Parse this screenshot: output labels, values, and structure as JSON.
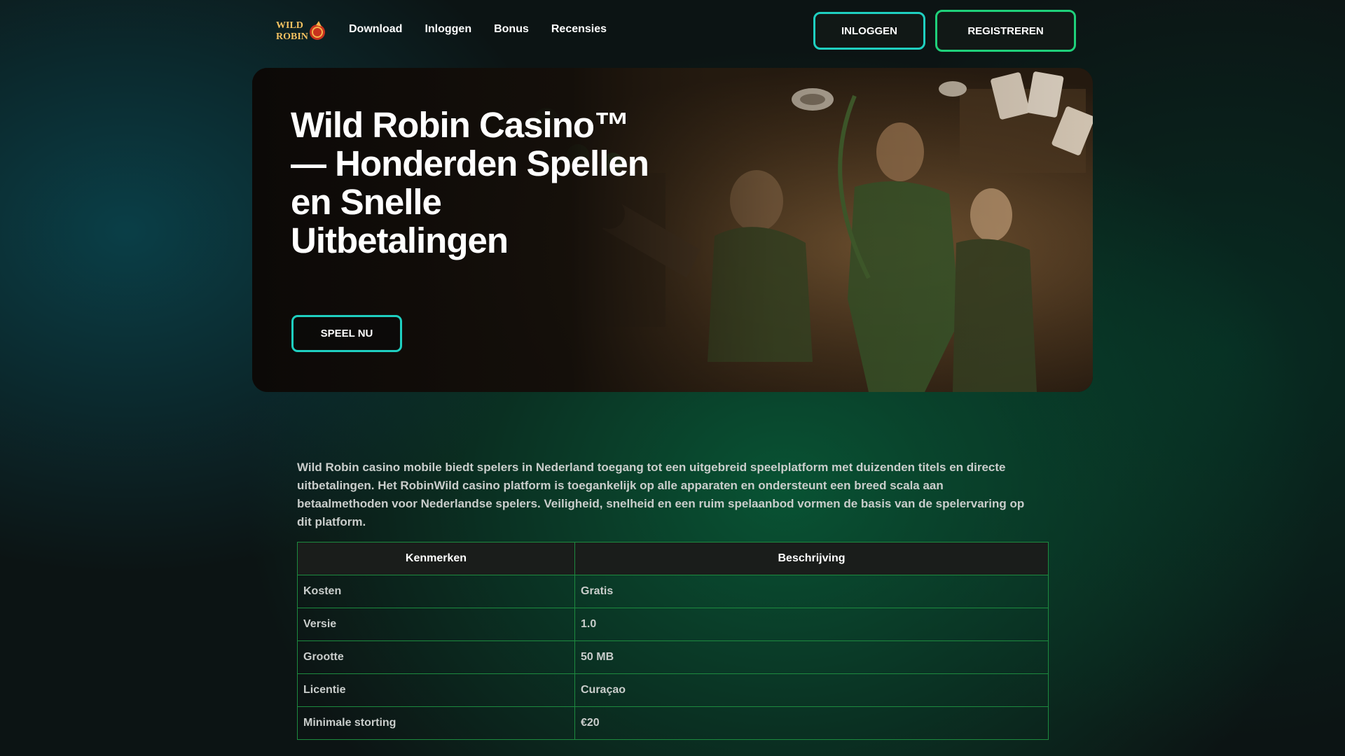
{
  "header": {
    "logo_text": [
      "WILD",
      "ROBIN"
    ],
    "nav": [
      "Download",
      "Inloggen",
      "Bonus",
      "Recensies"
    ],
    "login_label": "INLOGGEN",
    "register_label": "REGISTREREN"
  },
  "hero": {
    "title": "Wild Robin Casino™ — Honderden Spellen en Snelle Uitbetalingen",
    "cta_label": "SPEEL NU"
  },
  "intro": "Wild Robin casino mobile biedt spelers in Nederland toegang tot een uitgebreid speelplatform met duizenden titels en directe uitbetalingen. Het RobinWild casino platform is toegankelijk op alle apparaten en ondersteunt een breed scala aan betaalmethoden voor Nederlandse spelers. Veiligheid, snelheid en een ruim spelaanbod vormen de basis van de spelervaring op dit platform.",
  "table": {
    "headers": [
      "Kenmerken",
      "Beschrijving"
    ],
    "rows": [
      [
        "Kosten",
        "Gratis"
      ],
      [
        "Versie",
        "1.0"
      ],
      [
        "Grootte",
        "50 MB"
      ],
      [
        "Licentie",
        "Curaçao"
      ],
      [
        "Minimale storting",
        "€20"
      ]
    ]
  },
  "colors": {
    "accent_teal": "#1fcfc0",
    "accent_green": "#1fd07a",
    "table_border": "#1d8a3f"
  }
}
